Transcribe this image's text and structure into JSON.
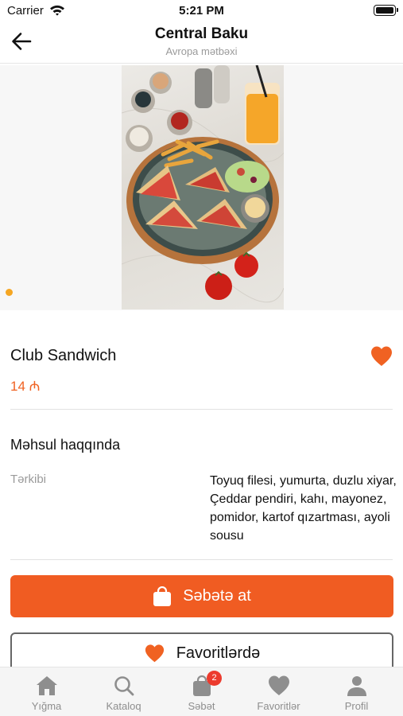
{
  "status_bar": {
    "carrier": "Carrier",
    "time": "5:21 PM"
  },
  "nav": {
    "title": "Central Baku",
    "subtitle": "Avropa mətbəxi"
  },
  "product": {
    "name": "Club Sandwich",
    "price": "14 ₼",
    "favorited": true,
    "gallery": {
      "current_page": 1,
      "total_pages": 1
    }
  },
  "about": {
    "title": "Məhsul haqqında",
    "ingredients_label": "Tərkibi",
    "ingredients_value": "Toyuq filesi, yumurta, duzlu xiyar, Çeddar pendiri, kahı, mayonez, pomidor, kartof qızartması, ayoli sousu"
  },
  "actions": {
    "add_to_cart_label": "Səbətə at",
    "favorites_label": "Favoritlərdə"
  },
  "tab_bar": {
    "tabs": [
      {
        "label": "Yığma",
        "icon": "home-icon"
      },
      {
        "label": "Kataloq",
        "icon": "search-icon"
      },
      {
        "label": "Səbət",
        "icon": "shopping-bag-icon",
        "badge": "2"
      },
      {
        "label": "Favoritlər",
        "icon": "heart-icon"
      },
      {
        "label": "Profil",
        "icon": "person-icon"
      }
    ]
  },
  "colors": {
    "accent": "#f05c22",
    "dot": "#f5a623",
    "badge": "#ec3b2e",
    "muted": "#8e8e8e"
  }
}
